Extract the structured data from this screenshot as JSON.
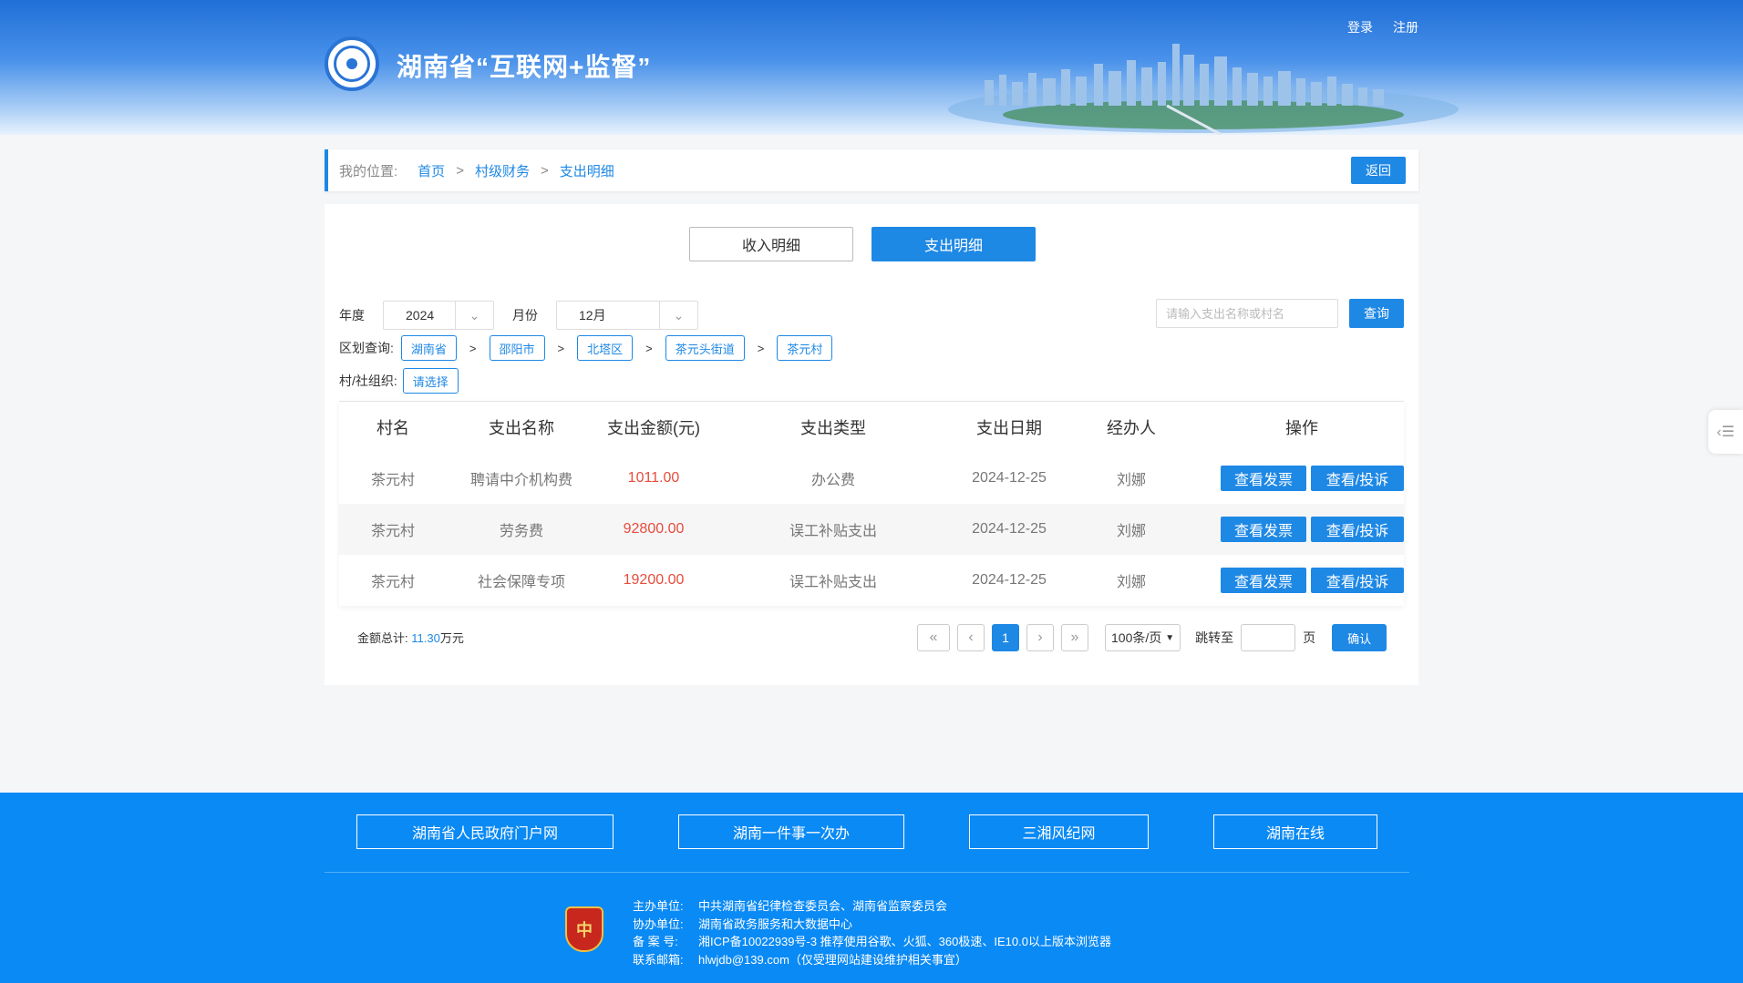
{
  "header": {
    "title": "湖南省“互联网+监督”",
    "login": "登录",
    "register": "注册"
  },
  "breadcrumb": {
    "label": "我的位置:",
    "items": [
      "首页",
      "村级财务",
      "支出明细"
    ],
    "separator": ">",
    "back": "返回"
  },
  "tabs": [
    {
      "label": "收入明细",
      "active": false
    },
    {
      "label": "支出明细",
      "active": true
    }
  ],
  "filters": {
    "year_label": "年度",
    "year_value": "2024",
    "month_label": "月份",
    "month_value": "12月",
    "search_placeholder": "请输入支出名称或村名",
    "query_button": "查询",
    "region_label": "区划查询:",
    "regions": [
      "湖南省",
      "邵阳市",
      "北塔区",
      "茶元头街道",
      "茶元村"
    ],
    "region_sep": ">",
    "org_label": "村/社组织:",
    "org_value": "请选择"
  },
  "table": {
    "columns": [
      "村名",
      "支出名称",
      "支出金额(元)",
      "支出类型",
      "支出日期",
      "经办人",
      "操作"
    ],
    "rows": [
      {
        "village": "茶元村",
        "name": "聘请中介机构费",
        "amount": "1011.00",
        "type": "办公费",
        "date": "2024-12-25",
        "handler": "刘娜"
      },
      {
        "village": "茶元村",
        "name": "劳务费",
        "amount": "92800.00",
        "type": "误工补贴支出",
        "date": "2024-12-25",
        "handler": "刘娜"
      },
      {
        "village": "茶元村",
        "name": "社会保障专项",
        "amount": "19200.00",
        "type": "误工补贴支出",
        "date": "2024-12-25",
        "handler": "刘娜"
      }
    ],
    "op_invoice": "查看发票",
    "op_complaint": "查看/投诉"
  },
  "summary": {
    "label": "金额总计:",
    "value": "11.30",
    "unit": "万元"
  },
  "pagination": {
    "current_page": "1",
    "per_page": "100条/页",
    "jump_label": "跳转至",
    "page_unit": "页",
    "confirm": "确认"
  },
  "footer": {
    "links": [
      "湖南省人民政府门户网",
      "湖南一件事一次办",
      "三湘风纪网",
      "湖南在线"
    ],
    "badge_text": "中",
    "info": [
      {
        "k": "主办单位:",
        "v": "中共湖南省纪律检查委员会、湖南省监察委员会"
      },
      {
        "k": "协办单位:",
        "v": "湖南省政务服务和大数据中心"
      },
      {
        "k": "备 案 号:",
        "v": "湘ICP备10022939号-3   推荐使用谷歌、火狐、360极速、IE10.0以上版本浏览器"
      },
      {
        "k": "联系邮箱:",
        "v": "hlwjdb@139.com（仅受理网站建设维护相关事宜）"
      }
    ]
  },
  "colors": {
    "accent": "#1e88e5",
    "money": "#e74c3c",
    "footer_bg": "#0a8af5"
  }
}
